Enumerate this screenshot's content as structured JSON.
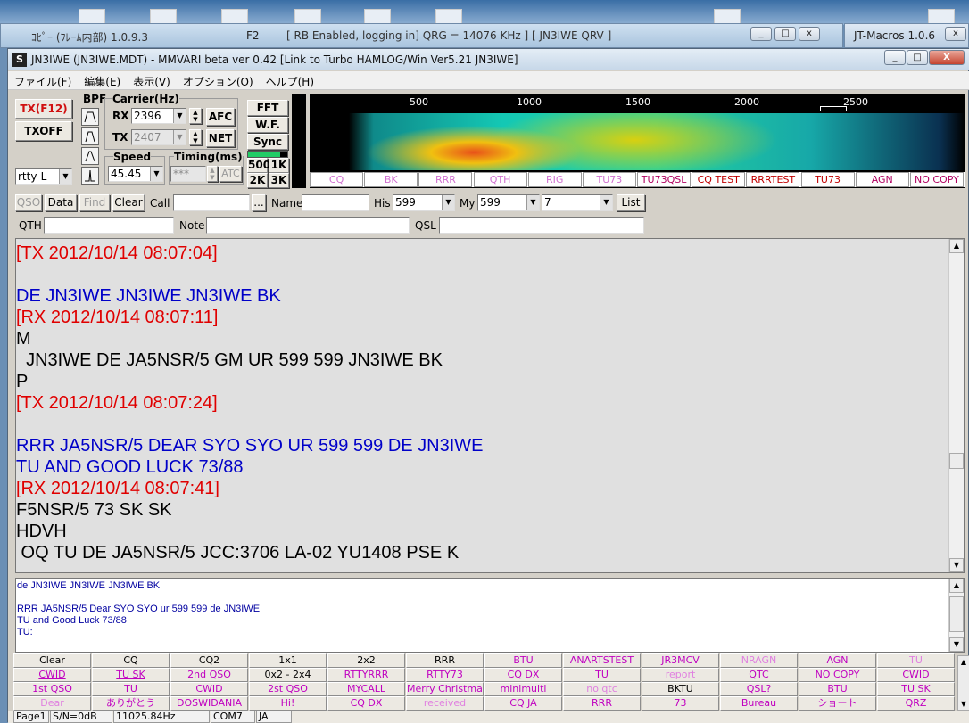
{
  "background_window": {
    "title": "ｺﾋﾟｰ (ﾌﾚｰﾑ内部)",
    "version": "1.0.9.3",
    "f2": "F2",
    "rest": "[ RB Enabled, logging in]  QRG = 14076 KHz ]  [ JN3IWE QRV ]"
  },
  "jt_window": {
    "title": "JT-Macros 1.0.6"
  },
  "window": {
    "logo": "S",
    "title": "JN3IWE (JN3IWE.MDT) - MMVARI beta ver 0.42 [Link to Turbo HAMLOG/Win Ver5.21 JN3IWE]",
    "min": "_",
    "max": "□",
    "close": "X"
  },
  "menu": [
    "ファイル(F)",
    "編集(E)",
    "表示(V)",
    "オプション(O)",
    "ヘルプ(H)"
  ],
  "panel": {
    "tx_button": "TX(F12)",
    "txoff_button": "TXOFF",
    "bpf_label": "BPF",
    "mode": "rtty-L",
    "carrier_label": "Carrier(Hz)",
    "rx_label": "RX",
    "rx_value": "2396",
    "tx_label": "TX",
    "tx_value": "2407",
    "afc": "AFC",
    "net": "NET",
    "speed_label": "Speed",
    "speed_value": "45.45",
    "timing_label": "Timing(ms)",
    "timing_value": "***",
    "atc": "ATC",
    "fft": "FFT",
    "wf": "W.F.",
    "sync": "Sync",
    "b500": "500",
    "b1k": "1K",
    "b2k": "2K",
    "b3k": "3K"
  },
  "waterfall": {
    "scale_ticks": [
      "500",
      "1000",
      "1500",
      "2000",
      "2500"
    ],
    "colors": {
      "low": "#0a2a4a",
      "mid": "#14c8b4",
      "high": "#f0e010",
      "peak": "#e8501a"
    }
  },
  "macro_bar1": [
    {
      "label": "CQ",
      "color": "#d070d0"
    },
    {
      "label": "BK",
      "color": "#d070d0"
    },
    {
      "label": "RRR",
      "color": "#d070d0"
    },
    {
      "label": "QTH",
      "color": "#d070d0"
    },
    {
      "label": "RIG",
      "color": "#d070d0"
    },
    {
      "label": "TU73",
      "color": "#d070d0"
    },
    {
      "label": "TU73QSL",
      "color": "#b00060"
    },
    {
      "label": "CQ TEST",
      "color": "#c00000"
    },
    {
      "label": "RRRTEST",
      "color": "#c00000"
    },
    {
      "label": "TU73",
      "color": "#c00000"
    },
    {
      "label": "AGN",
      "color": "#b00060"
    },
    {
      "label": "NO COPY",
      "color": "#b00060"
    }
  ],
  "row2": {
    "qso": "QSO",
    "data": "Data",
    "find": "Find",
    "clear": "Clear",
    "call_label": "Call",
    "call_value": "",
    "dots": "...",
    "name_label": "Name",
    "name_value": "",
    "his_label": "His",
    "his_value": "599",
    "my_label": "My",
    "my_value": "599",
    "band_value": "7",
    "list": "List"
  },
  "row3": {
    "qth_label": "QTH",
    "note_label": "Note",
    "qsl_label": "QSL"
  },
  "rx_lines": [
    {
      "text": "[TX 2012/10/14 08:07:04]",
      "color": "red"
    },
    {
      "text": "",
      "color": "black"
    },
    {
      "text": "DE JN3IWE JN3IWE JN3IWE BK",
      "color": "blue"
    },
    {
      "text": "[RX 2012/10/14 08:07:11]",
      "color": "red"
    },
    {
      "text": "M",
      "color": "black"
    },
    {
      "text": "  JN3IWE DE JA5NSR/5 GM UR 599 599 JN3IWE BK",
      "color": "black"
    },
    {
      "text": "P",
      "color": "black"
    },
    {
      "text": "[TX 2012/10/14 08:07:24]",
      "color": "red"
    },
    {
      "text": "",
      "color": "black"
    },
    {
      "text": "RRR JA5NSR/5 DEAR SYO SYO UR 599 599 DE JN3IWE",
      "color": "blue"
    },
    {
      "text": "TU AND GOOD LUCK 73/88",
      "color": "blue"
    },
    {
      "text": "[RX 2012/10/14 08:07:41]",
      "color": "red"
    },
    {
      "text": "F5NSR/5 73 SK SK",
      "color": "black"
    },
    {
      "text": "HDVH",
      "color": "black"
    },
    {
      "text": " OQ TU DE JA5NSR/5 JCC:3706 LA-02 YU1408 PSE K",
      "color": "black"
    }
  ],
  "tx_lines": [
    "de JN3IWE JN3IWE JN3IWE BK",
    "",
    "RRR JA5NSR/5 Dear SYO SYO ur 599 599 de JN3IWE",
    "TU and Good Luck 73/88",
    "TU:"
  ],
  "macro_grid": [
    [
      {
        "label": "Clear",
        "color": "#000000"
      },
      {
        "label": "CQ",
        "color": "#000000"
      },
      {
        "label": "CQ2",
        "color": "#000000"
      },
      {
        "label": "1x1",
        "color": "#000000"
      },
      {
        "label": "2x2",
        "color": "#000000"
      },
      {
        "label": "RRR",
        "color": "#000000"
      },
      {
        "label": "BTU",
        "color": "#c000c0"
      },
      {
        "label": "ANARTSTEST",
        "color": "#c000c0"
      },
      {
        "label": "JR3MCV",
        "color": "#c000c0"
      },
      {
        "label": "NRAGN",
        "color": "#e080e0"
      },
      {
        "label": "AGN",
        "color": "#c000c0"
      },
      {
        "label": "TU",
        "color": "#e080e0"
      }
    ],
    [
      {
        "label": "CWID",
        "color": "#c000c0"
      },
      {
        "label": "TU SK",
        "color": "#c000c0"
      },
      {
        "label": "2nd QSO",
        "color": "#c000c0"
      },
      {
        "label": "0x2 - 2x4",
        "color": "#000000"
      },
      {
        "label": "RTTYRRR",
        "color": "#c000c0"
      },
      {
        "label": "RTTY73",
        "color": "#c000c0"
      },
      {
        "label": "CQ DX",
        "color": "#c000c0"
      },
      {
        "label": "TU",
        "color": "#c000c0"
      },
      {
        "label": "report",
        "color": "#e080e0"
      },
      {
        "label": "QTC",
        "color": "#c000c0"
      },
      {
        "label": "NO COPY",
        "color": "#c000c0"
      },
      {
        "label": "CWID",
        "color": "#c000c0"
      }
    ],
    [
      {
        "label": "1st QSO",
        "color": "#c000c0"
      },
      {
        "label": "TU",
        "color": "#c000c0"
      },
      {
        "label": "CWID",
        "color": "#c000c0"
      },
      {
        "label": "2st QSO",
        "color": "#c000c0"
      },
      {
        "label": "MYCALL",
        "color": "#c000c0"
      },
      {
        "label": "Merry Christmas",
        "color": "#c000c0"
      },
      {
        "label": "minimulti",
        "color": "#c000c0"
      },
      {
        "label": "no qtc",
        "color": "#e080e0"
      },
      {
        "label": "BKTU",
        "color": "#000000"
      },
      {
        "label": "QSL?",
        "color": "#c000c0"
      },
      {
        "label": "BTU",
        "color": "#c000c0"
      },
      {
        "label": "TU SK",
        "color": "#c000c0"
      }
    ],
    [
      {
        "label": "Dear",
        "color": "#e080e0"
      },
      {
        "label": "ありがとう",
        "color": "#c000c0"
      },
      {
        "label": "DOSWIDANIA",
        "color": "#c000c0"
      },
      {
        "label": "Hi!",
        "color": "#c000c0"
      },
      {
        "label": "CQ DX",
        "color": "#c000c0"
      },
      {
        "label": "received",
        "color": "#e080e0"
      },
      {
        "label": "CQ JA",
        "color": "#c000c0"
      },
      {
        "label": "RRR",
        "color": "#c000c0"
      },
      {
        "label": "73",
        "color": "#c000c0"
      },
      {
        "label": "Bureau",
        "color": "#c000c0"
      },
      {
        "label": "ショート",
        "color": "#c000c0"
      },
      {
        "label": "QRZ",
        "color": "#c000c0"
      }
    ]
  ],
  "status": {
    "page": "Page1",
    "sn": "S/N=0dB",
    "clock": "11025.84Hz",
    "com": "COM7",
    "lang": "JA"
  }
}
